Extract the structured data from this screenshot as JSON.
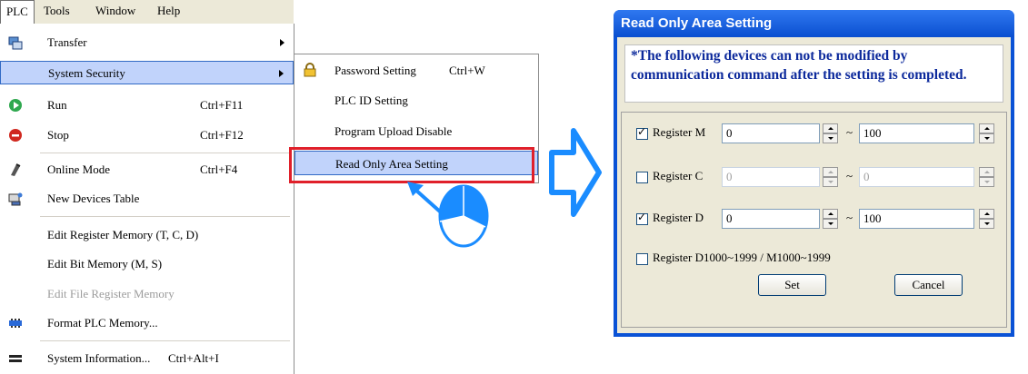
{
  "menubar": {
    "items": [
      {
        "label": "PLC"
      },
      {
        "label": "Tools"
      },
      {
        "label": "Window"
      },
      {
        "label": "Help"
      }
    ]
  },
  "plc_menu": {
    "transfer": {
      "label": "Transfer",
      "icon": "transfer-icon"
    },
    "system_security": {
      "label": "System Security"
    },
    "run": {
      "label": "Run",
      "shortcut": "Ctrl+F11",
      "icon": "run-icon"
    },
    "stop": {
      "label": "Stop",
      "shortcut": "Ctrl+F12",
      "icon": "stop-icon"
    },
    "online_mode": {
      "label": "Online Mode",
      "shortcut": "Ctrl+F4",
      "icon": "online-mode-icon"
    },
    "new_devices_table": {
      "label": "New Devices Table",
      "icon": "devices-table-icon"
    },
    "edit_register_memory": {
      "label": "Edit Register Memory (T, C, D)"
    },
    "edit_bit_memory": {
      "label": "Edit Bit Memory (M, S)"
    },
    "edit_file_register_memory": {
      "label": "Edit File Register Memory"
    },
    "format_plc_memory": {
      "label": "Format PLC Memory...",
      "icon": "memory-icon"
    },
    "system_information": {
      "label": "System Information...",
      "shortcut": "Ctrl+Alt+I",
      "icon": "info-icon"
    }
  },
  "security_submenu": {
    "password_setting": {
      "label": "Password Setting",
      "shortcut": "Ctrl+W",
      "icon": "lock-icon"
    },
    "plc_id_setting": {
      "label": "PLC ID Setting"
    },
    "program_upload_disable": {
      "label": "Program Upload Disable"
    },
    "read_only_area_setting": {
      "label": "Read Only Area Setting"
    }
  },
  "dialog": {
    "title": "Read Only Area Setting",
    "notice": "*The following devices can not be modified by communication command after the setting is completed.",
    "rows": [
      {
        "label": "Register M",
        "checked": true,
        "from": "0",
        "to": "100",
        "enabled": true
      },
      {
        "label": "Register C",
        "checked": false,
        "from": "0",
        "to": "0",
        "enabled": false
      },
      {
        "label": "Register D",
        "checked": true,
        "from": "0",
        "to": "100",
        "enabled": true
      }
    ],
    "range_separator": "~",
    "extended": {
      "label": "Register D1000~1999 / M1000~1999",
      "checked": false
    },
    "set_label": "Set",
    "cancel_label": "Cancel"
  },
  "colors": {
    "menu_highlight": "#c1d3fb",
    "callout_border": "#e0202a",
    "arrow_blue": "#1a8cff",
    "dialog_title": "#0a52d6",
    "notice_text": "#0d2a9c"
  }
}
